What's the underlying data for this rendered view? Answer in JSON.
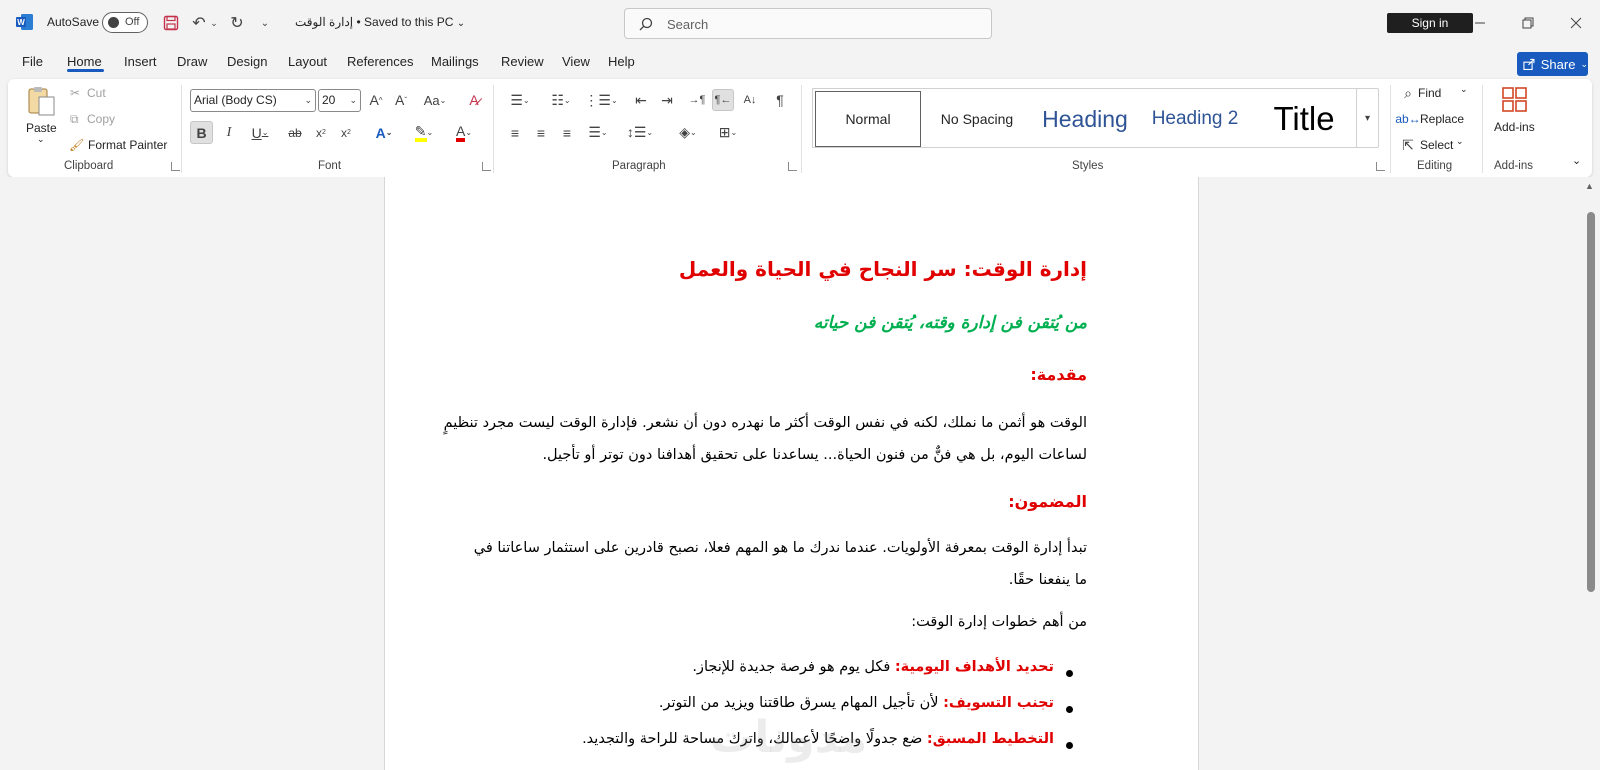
{
  "titlebar": {
    "autosave_label": "AutoSave",
    "autosave_state": "Off",
    "doc_name": "إدارة الوقت",
    "save_status": "• Saved to this PC",
    "search_placeholder": "Search",
    "signin_label": "Sign in"
  },
  "menu": {
    "tabs": [
      "File",
      "Home",
      "Insert",
      "Draw",
      "Design",
      "Layout",
      "References",
      "Mailings",
      "Review",
      "View",
      "Help"
    ],
    "active": "Home",
    "share_label": "Share"
  },
  "ribbon": {
    "clipboard": {
      "paste": "Paste",
      "cut": "Cut",
      "copy": "Copy",
      "format_painter": "Format Painter",
      "label": "Clipboard"
    },
    "font": {
      "family": "Arial (Body CS)",
      "size": "20",
      "label": "Font"
    },
    "paragraph": {
      "label": "Paragraph"
    },
    "styles": {
      "items": [
        "Normal",
        "No Spacing",
        "Heading",
        "Heading 2",
        "Title"
      ],
      "label": "Styles"
    },
    "editing": {
      "find": "Find",
      "replace": "Replace",
      "select": "Select",
      "label": "Editing"
    },
    "addins": {
      "button": "Add-ins",
      "label": "Add-ins"
    }
  },
  "document": {
    "title": "إدارة الوقت: سر النجاح في الحياة والعمل",
    "subtitle": "من يُتقن فن إدارة وقته، يُتقن فن حياته",
    "intro_heading": "مقدمة:",
    "intro_line1": "الوقت هو أثمن ما نملك، لكنه في نفس الوقت أكثر ما نهدره دون أن نشعر. فإدارة الوقت ليست مجرد تنظيمٍ",
    "intro_line2": "لساعات اليوم، بل هي فنٌّ من فنون الحياة... يساعدنا على تحقيق أهدافنا دون توتر أو تأجيل.",
    "content_heading": "المضمون:",
    "content_line1": "تبدأ إدارة الوقت بمعرفة الأولويات. عندما ندرك ما هو المهم فعلا، نصبح قادرين على استثمار ساعاتنا في",
    "content_line2": "ما ينفعنا حقًا.",
    "steps_intro": "من أهم خطوات إدارة الوقت:",
    "bullets": [
      {
        "label": "تحديد الأهداف اليومية:",
        "text": " فكل يوم هو فرصة جديدة للإنجاز."
      },
      {
        "label": "تجنب التسويف:",
        "text": " لأن تأجيل المهام يسرق طاقتنا ويزيد من التوتر."
      },
      {
        "label": "التخطيط المسبق:",
        "text": " ضع جدولًا واضحًا لأعمالك، واترك مساحة للراحة والتجديد."
      }
    ]
  },
  "colors": {
    "accent": "#185abd",
    "heading_red": "#e00000",
    "subtitle_green": "#00b050"
  }
}
